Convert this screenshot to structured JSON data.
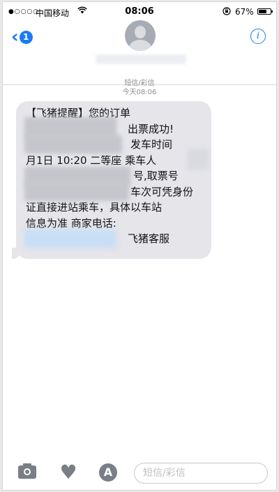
{
  "status_bar": {
    "signal": "●○○○○",
    "carrier": "中国移动",
    "time": "08:06",
    "battery_percent": "67%",
    "battery_level": 0.67
  },
  "header": {
    "back_badge": "1",
    "info_label": "i"
  },
  "conversation": {
    "message_type": "短信/彩信",
    "timestamp": "今天08:06",
    "message": {
      "lines": [
        "【飞猪提醒】您的订单",
        "出票成功!",
        "发车时间",
        "月1日 10:20 二等座 乘车人",
        "号,取票号",
        "车次可凭身份",
        "证直接进站乘车，具体以车站",
        "信息为准 商家电话:",
        "飞猪客服"
      ]
    }
  },
  "input_bar": {
    "placeholder": "短信/彩信",
    "value": "",
    "icons": [
      "camera-icon",
      "digital-touch-heart-icon",
      "app-store-icon"
    ]
  },
  "colors": {
    "accent": "#1a7bf4",
    "bubble": "#e5e5ea",
    "meta_text": "#8e8e93"
  }
}
